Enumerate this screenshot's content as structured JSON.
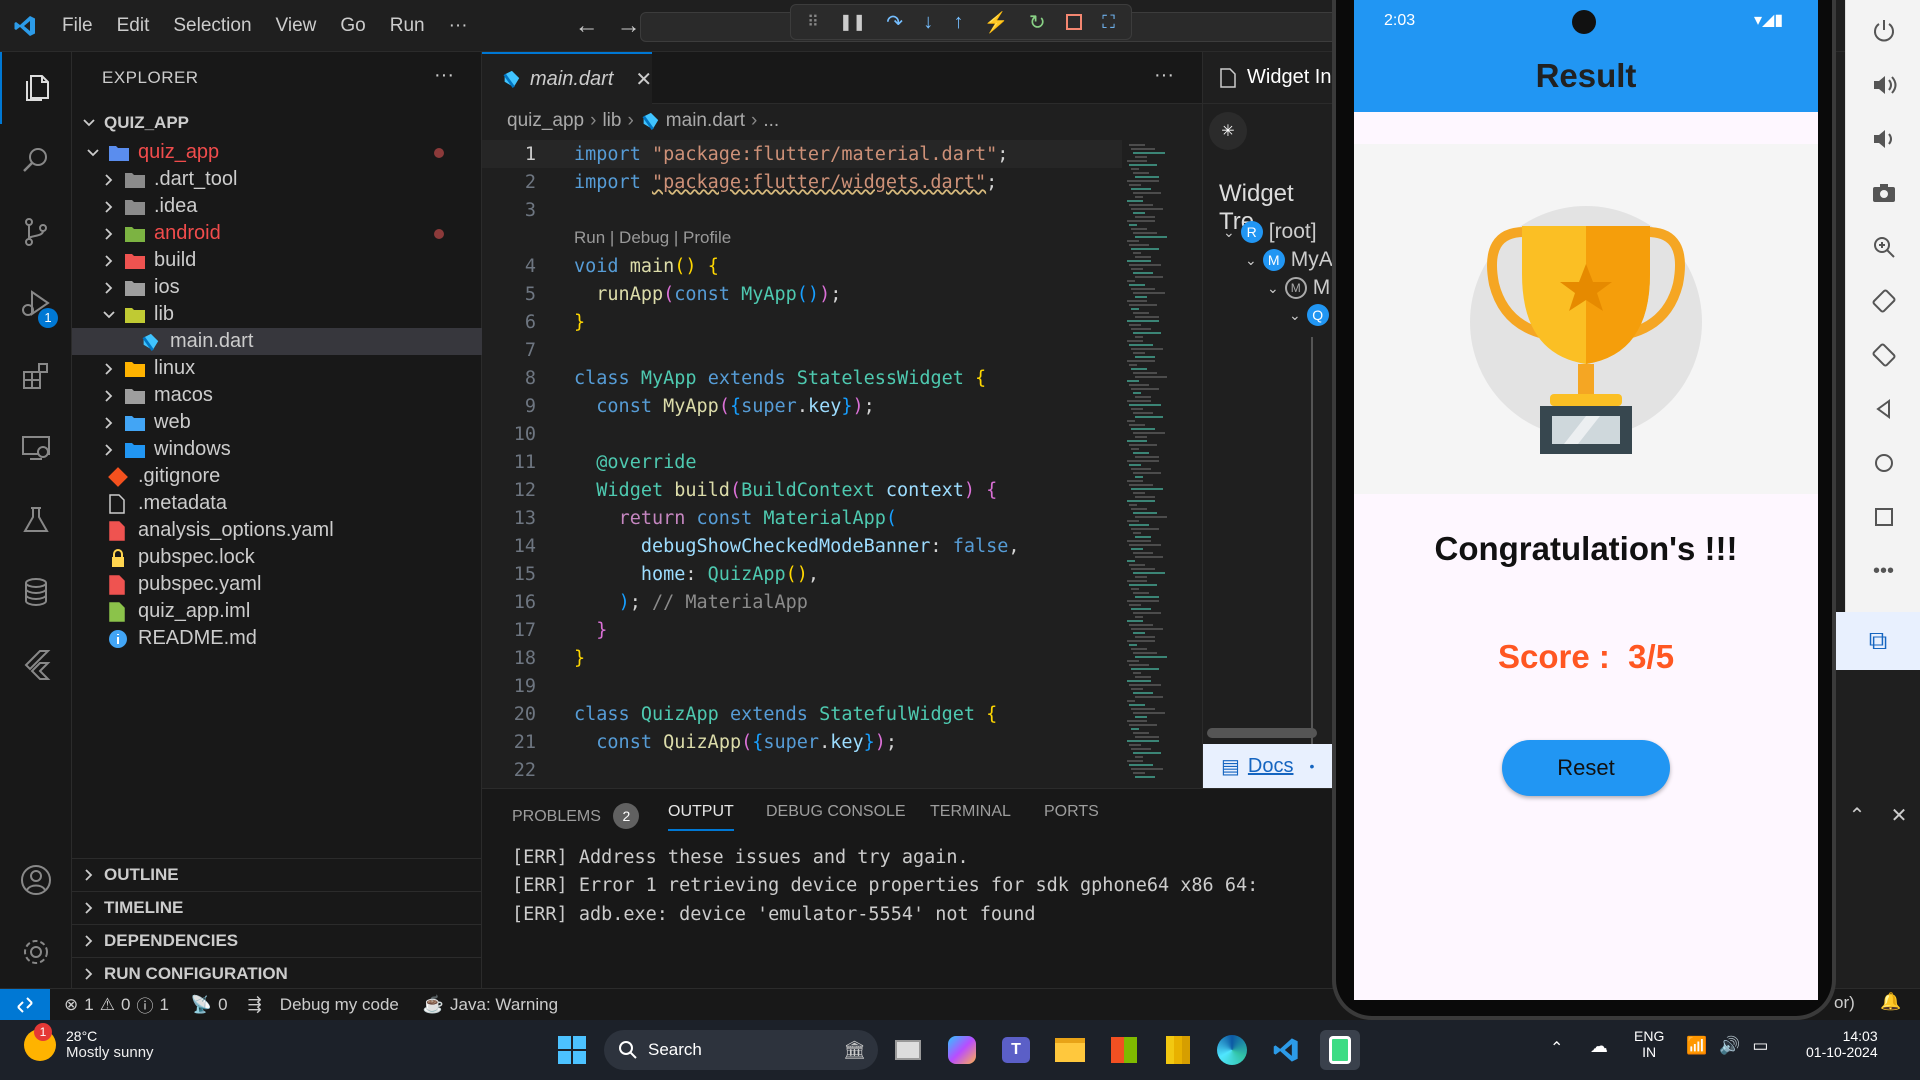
{
  "menubar": {
    "items": [
      "File",
      "Edit",
      "Selection",
      "View",
      "Go",
      "Run",
      "···"
    ]
  },
  "activity": {
    "debug_badge": "1"
  },
  "explorer": {
    "title": "EXPLORER",
    "more": "···",
    "root": "QUIZ_APP",
    "items": [
      {
        "label": "quiz_app",
        "icon": "folder-open-icon",
        "color": "#f14c4c"
      },
      {
        "label": ".dart_tool",
        "icon": "folder-icon",
        "color": "#cccccc"
      },
      {
        "label": ".idea",
        "icon": "folder-icon",
        "color": "#cccccc"
      },
      {
        "label": "android",
        "icon": "folder-android-icon",
        "color": "#f14c4c"
      },
      {
        "label": "build",
        "icon": "folder-build-icon",
        "color": "#cccccc"
      },
      {
        "label": "ios",
        "icon": "folder-ios-icon",
        "color": "#cccccc"
      },
      {
        "label": "lib",
        "icon": "folder-lib-icon",
        "color": "#cccccc"
      },
      {
        "label": "main.dart",
        "icon": "dart-icon",
        "color": "#cccccc"
      },
      {
        "label": "linux",
        "icon": "folder-linux-icon",
        "color": "#cccccc"
      },
      {
        "label": "macos",
        "icon": "folder-macos-icon",
        "color": "#cccccc"
      },
      {
        "label": "web",
        "icon": "folder-web-icon",
        "color": "#cccccc"
      },
      {
        "label": "windows",
        "icon": "folder-windows-icon",
        "color": "#cccccc"
      },
      {
        "label": ".gitignore",
        "icon": "git-icon",
        "color": "#cccccc"
      },
      {
        "label": ".metadata",
        "icon": "file-icon",
        "color": "#cccccc"
      },
      {
        "label": "analysis_options.yaml",
        "icon": "yaml-icon",
        "color": "#cccccc"
      },
      {
        "label": "pubspec.lock",
        "icon": "lock-icon",
        "color": "#cccccc"
      },
      {
        "label": "pubspec.yaml",
        "icon": "yaml-icon",
        "color": "#cccccc"
      },
      {
        "label": "quiz_app.iml",
        "icon": "iml-icon",
        "color": "#cccccc"
      },
      {
        "label": "README.md",
        "icon": "info-icon",
        "color": "#cccccc"
      }
    ],
    "sections": [
      "OUTLINE",
      "TIMELINE",
      "DEPENDENCIES",
      "RUN CONFIGURATION"
    ]
  },
  "editor": {
    "tab_label": "main.dart",
    "more": "···",
    "breadcrumb": [
      "quiz_app",
      "lib",
      "main.dart",
      "..."
    ],
    "codelens": "Run | Debug | Profile",
    "widget_tab": "Widget In",
    "widget_tree_title": "Widget Tre",
    "widget_tree": [
      "[root]",
      "MyA",
      "M"
    ],
    "docs_label": "Docs",
    "docs_more": "•"
  },
  "panel": {
    "tabs": [
      "PROBLEMS",
      "OUTPUT",
      "DEBUG CONSOLE",
      "TERMINAL",
      "PORTS"
    ],
    "problems_count": "2",
    "output_lines": [
      "[ERR] Address these issues and try again.",
      "[ERR] Error 1 retrieving device properties for sdk gphone64 x86 64:",
      "[ERR] adb.exe: device 'emulator-5554' not found"
    ]
  },
  "statusbar": {
    "errors": "1",
    "warnings": "0",
    "infos": "1",
    "ports": "0",
    "debug_label": "Debug my code",
    "java_label": "Java: Warning",
    "right_fragment": "or)"
  },
  "phone": {
    "time": "2:03",
    "appbar_title": "Result",
    "congrats": "Congratulation's !!!",
    "score_label": "Score :",
    "score_value": "3/5",
    "reset_label": "Reset",
    "accent": "#2196f3",
    "score_color": "#ff5722"
  },
  "taskbar": {
    "weather_temp": "28°C",
    "weather_desc": "Mostly sunny",
    "weather_badge": "1",
    "search_label": "Search",
    "lang_top": "ENG",
    "lang_bottom": "IN",
    "time": "14:03",
    "date": "01-10-2024"
  }
}
